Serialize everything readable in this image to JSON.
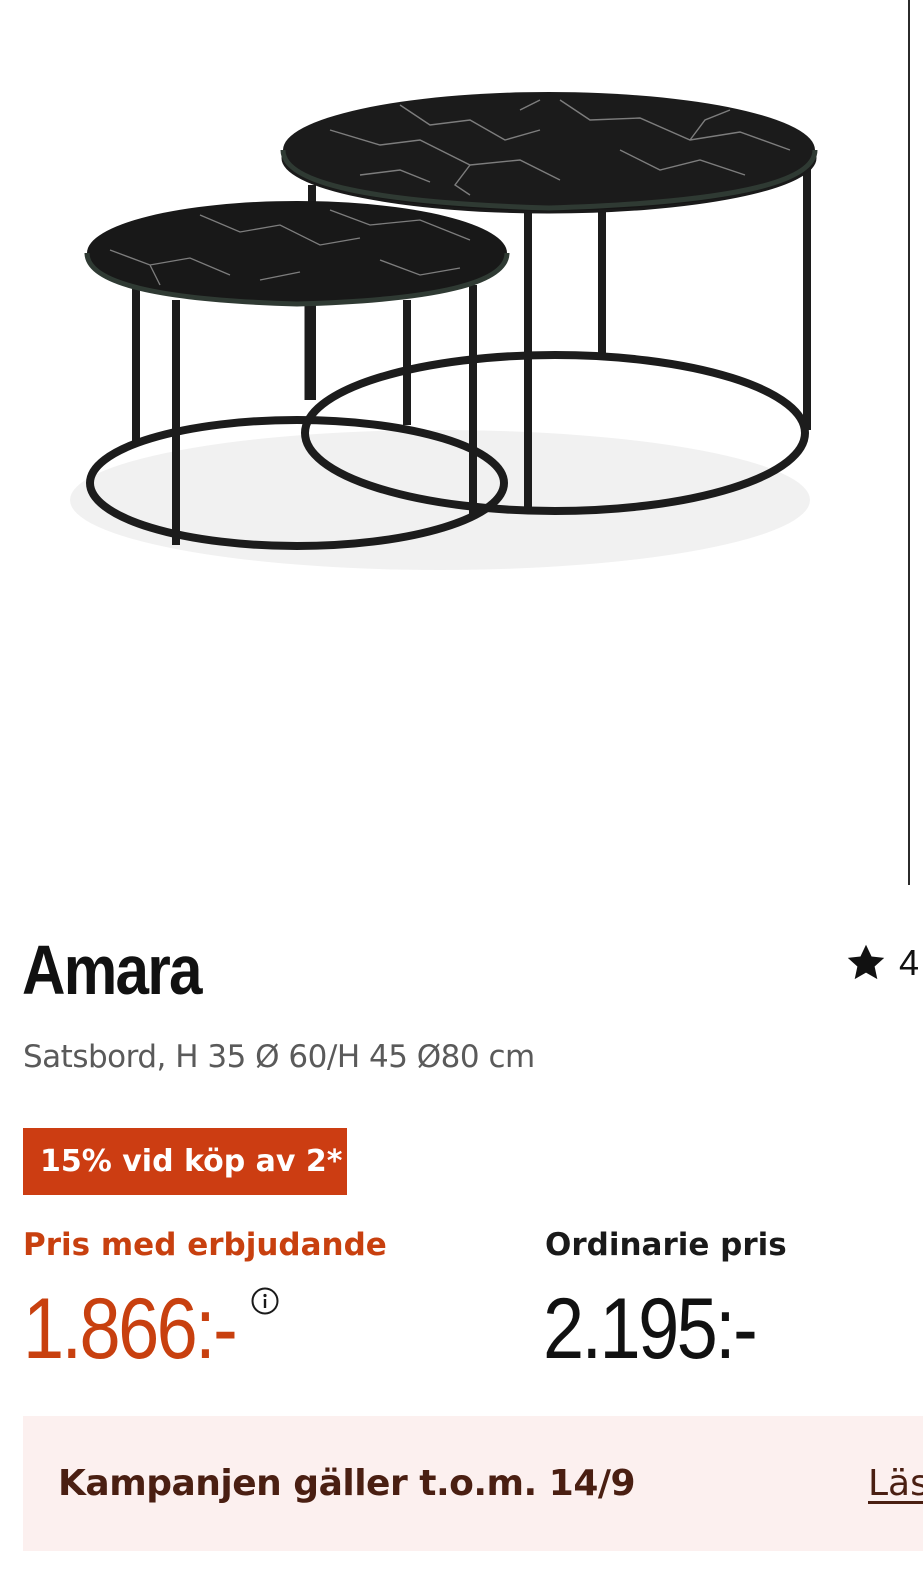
{
  "product": {
    "image_alt": "Amara satsbord",
    "name": "Amara",
    "description": "Satsbord, H 35 Ø 60/H 45 Ø80 cm",
    "rating": {
      "icon": "star-icon",
      "value": "4"
    }
  },
  "promo": {
    "badge": "15% vid köp av 2*"
  },
  "pricing": {
    "offer_label": "Pris med erbjudande",
    "offer_price": "1.866:-",
    "info_icon": "info-icon",
    "regular_label": "Ordinarie pris",
    "regular_price": "2.195:-"
  },
  "campaign": {
    "text": "Kampanjen gäller t.o.m. 14/9",
    "link": "Läs mer"
  },
  "colors": {
    "accent": "#cc3d12",
    "offer_text": "#c8400f",
    "campaign_bg": "#fcf0ef",
    "campaign_text": "#4a1f12"
  }
}
